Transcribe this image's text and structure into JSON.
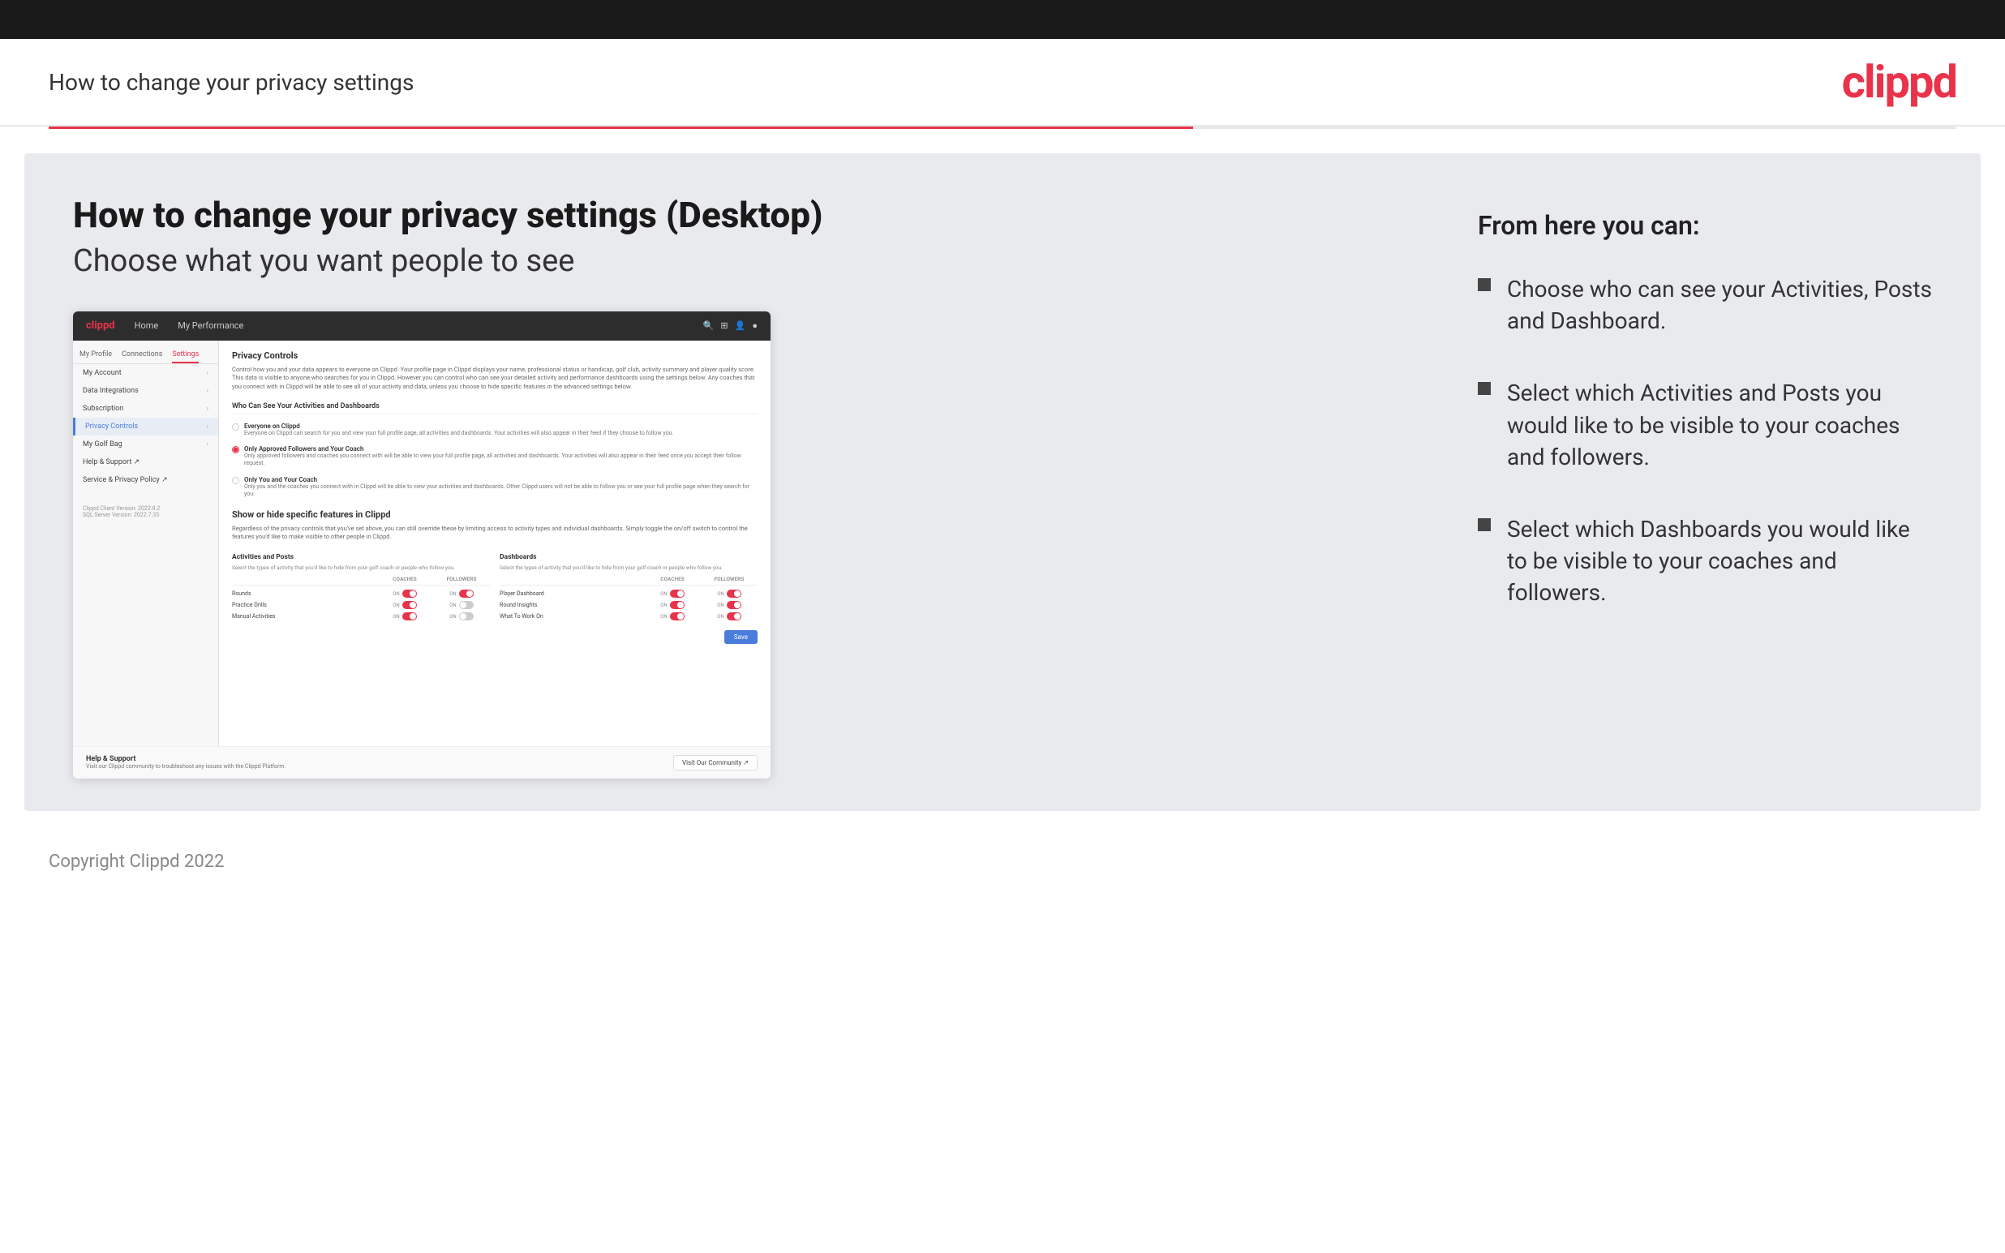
{
  "topBar": {},
  "header": {
    "title": "How to change your privacy settings",
    "logo": "clippd"
  },
  "mainContent": {
    "heading": "How to change your privacy settings (Desktop)",
    "subheading": "Choose what you want people to see",
    "screenshot": {
      "navbar": {
        "logo": "clippd",
        "items": [
          "Home",
          "My Performance"
        ],
        "icons": [
          "search",
          "grid",
          "person",
          "avatar"
        ]
      },
      "sidebar": {
        "tabs": [
          "My Profile",
          "Connections",
          "Settings"
        ],
        "activeTab": "Settings",
        "items": [
          {
            "label": "My Account",
            "active": false
          },
          {
            "label": "Data Integrations",
            "active": false
          },
          {
            "label": "Subscription",
            "active": false
          },
          {
            "label": "Privacy Controls",
            "active": true
          },
          {
            "label": "My Golf Bag",
            "active": false
          },
          {
            "label": "Help & Support ↗",
            "active": false
          },
          {
            "label": "Service & Privacy Policy ↗",
            "active": false
          }
        ],
        "version": "Clippd Client Version: 2022.8.2\nSQL Server Version: 2022.7.35"
      },
      "main": {
        "sectionTitle": "Privacy Controls",
        "sectionDesc": "Control how you and your data appears to everyone on Clippd. Your profile page in Clippd displays your name, professional status or handicap, golf club, activity summary and player quality score. This data is visible to anyone who searches for you in Clippd. However you can control who can see your detailed activity and performance dashboards using the settings below. Any coaches that you connect with in Clippd will be able to see all of your activity and data, unless you choose to hide specific features in the advanced settings below.",
        "subsectionTitle": "Who Can See Your Activities and Dashboards",
        "radioOptions": [
          {
            "id": "everyone",
            "label": "Everyone on Clippd",
            "desc": "Everyone on Clippd can search for you and view your full profile page, all activities and dashboards. Your activities will also appear in their feed if they choose to follow you.",
            "selected": false
          },
          {
            "id": "followers",
            "label": "Only Approved Followers and Your Coach",
            "desc": "Only approved followers and coaches you connect with will be able to view your full profile page, all activities and dashboards. Your activities will also appear in their feed once you accept their follow request.",
            "selected": true
          },
          {
            "id": "coach",
            "label": "Only You and Your Coach",
            "desc": "Only you and the coaches you connect with in Clippd will be able to view your activities and dashboards. Other Clippd users will not be able to follow you or see your full profile page when they search for you.",
            "selected": false
          }
        ],
        "showHideTitle": "Show or hide specific features in Clippd",
        "showHideDesc": "Regardless of the privacy controls that you've set above, you can still override these by limiting access to activity types and individual dashboards. Simply toggle the on/off switch to control the features you'd like to make visible to other people in Clippd.",
        "activitiesTable": {
          "title": "Activities and Posts",
          "desc": "Select the types of activity that you'd like to hide from your golf coach or people who follow you.",
          "headers": [
            "",
            "COACHES",
            "FOLLOWERS"
          ],
          "rows": [
            {
              "label": "Rounds",
              "coaches": "on",
              "followers": "on"
            },
            {
              "label": "Practice Drills",
              "coaches": "on",
              "followers": "off"
            },
            {
              "label": "Manual Activities",
              "coaches": "on",
              "followers": "off"
            }
          ]
        },
        "dashboardsTable": {
          "title": "Dashboards",
          "desc": "Select the types of activity that you'd like to hide from your golf coach or people who follow you.",
          "headers": [
            "",
            "COACHES",
            "FOLLOWERS"
          ],
          "rows": [
            {
              "label": "Player Dashboard",
              "coaches": "on",
              "followers": "on"
            },
            {
              "label": "Round Insights",
              "coaches": "on",
              "followers": "on"
            },
            {
              "label": "What To Work On",
              "coaches": "on",
              "followers": "on"
            }
          ]
        },
        "saveButton": "Save",
        "helpSection": {
          "title": "Help & Support",
          "desc": "Visit our Clippd community to troubleshoot any issues with the Clippd Platform.",
          "buttonLabel": "Visit Our Community ↗"
        }
      }
    },
    "rightPanel": {
      "heading": "From here you can:",
      "bullets": [
        "Choose who can see your Activities, Posts and Dashboard.",
        "Select which Activities and Posts you would like to be visible to your coaches and followers.",
        "Select which Dashboards you would like to be visible to your coaches and followers."
      ]
    }
  },
  "footer": {
    "copyright": "Copyright Clippd 2022"
  }
}
